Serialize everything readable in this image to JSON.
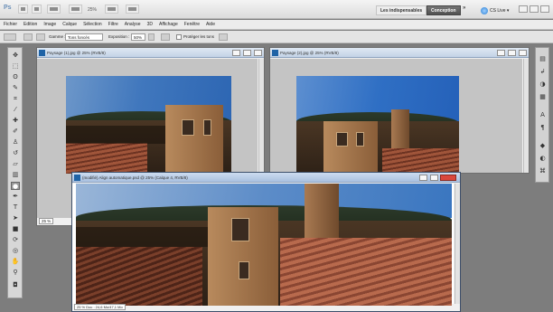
{
  "app": {
    "logo_text": "Ps",
    "zoom_level": "25%",
    "workspaces": {
      "inactive": "Les indispensables",
      "active": "Conception"
    },
    "more": "»",
    "cs_live": "CS Live ▾"
  },
  "menu": [
    "Fichier",
    "Edition",
    "Image",
    "Calque",
    "Sélection",
    "Filtre",
    "Analyse",
    "3D",
    "Affichage",
    "Fenêtre",
    "Aide"
  ],
  "options_bar": {
    "gamme_label": "Gamme :",
    "gamme_value": "Tons foncés",
    "exposition_label": "Exposition :",
    "exposition_value": "50%",
    "protect_tones_label": "Protéger les tons"
  },
  "documents": [
    {
      "title": "Paysage (1).jpg @ 25% (RVB/8)",
      "zoom": "25 %"
    },
    {
      "title": "Paysage (2).jpg @ 25% (RVB/8)",
      "zoom": ""
    },
    {
      "title": "(modifié) Align automatique.psd @ 25% (Calque 4, RVB/8)",
      "status": "25 %      Doc : 24,6 Mo/47,1 Mo"
    }
  ]
}
